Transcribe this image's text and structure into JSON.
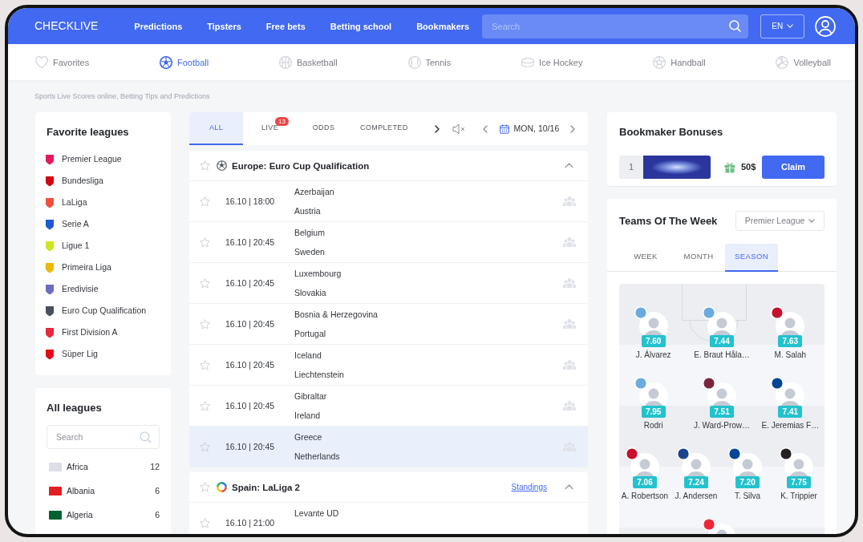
{
  "header": {
    "logo": "CHECKLIVE",
    "menu": [
      "Predictions",
      "Tipsters",
      "Free bets",
      "Betting school",
      "Bookmakers"
    ],
    "search": {
      "placeholder": "Search"
    },
    "language": "EN"
  },
  "sports": [
    {
      "kind": "favorites",
      "label": "Favorites",
      "selected": false
    },
    {
      "kind": "football",
      "label": "Football",
      "selected": true
    },
    {
      "kind": "basketball",
      "label": "Basketball",
      "selected": false
    },
    {
      "kind": "tennis",
      "label": "Tennis",
      "selected": false
    },
    {
      "kind": "ice_hockey",
      "label": "Ice Hockey",
      "selected": false
    },
    {
      "kind": "handball",
      "label": "Handball",
      "selected": false
    },
    {
      "kind": "volleyball",
      "label": "Volleyball",
      "selected": false
    }
  ],
  "tagline": "Sports Live Scores online, Betting Tips and Predictions",
  "favorite_leagues": {
    "title": "Favorite leagues",
    "items": [
      {
        "name": "Premier League",
        "color": "#e5195f"
      },
      {
        "name": "Bundesliga",
        "color": "#d20515"
      },
      {
        "name": "LaLiga",
        "color": "#f0503c"
      },
      {
        "name": "Serie A",
        "color": "#1e5ad2"
      },
      {
        "name": "Ligue 1",
        "color": "#cde61e"
      },
      {
        "name": "Primeira Liga",
        "color": "#e8b90c"
      },
      {
        "name": "Eredivisie",
        "color": "#6c6cc0"
      },
      {
        "name": "Euro Cup Qualification",
        "color": "#4a4f5c"
      },
      {
        "name": "First Division A",
        "color": "#e8283c"
      },
      {
        "name": "Süper Lig",
        "color": "#e30a17"
      }
    ]
  },
  "all_leagues": {
    "title": "All leagues",
    "search": {
      "placeholder": "Search"
    },
    "items": [
      {
        "name": "Africa",
        "count": "12",
        "color": "#dcdfe8"
      },
      {
        "name": "Albania",
        "count": "6",
        "color": "#e41e20"
      },
      {
        "name": "Algeria",
        "count": "6",
        "color": "#006233"
      }
    ]
  },
  "match_tabs": [
    {
      "label": "ALL",
      "selected": true
    },
    {
      "label": "LIVE",
      "badge": "13",
      "selected": false
    },
    {
      "label": "ODDS",
      "selected": false
    },
    {
      "label": "COMPLETED",
      "selected": false
    }
  ],
  "date": "MON, 10/16",
  "groups": [
    {
      "kind": "cup",
      "title": "Europe: Euro Cup Qualification",
      "expanded": true,
      "matches": [
        {
          "time": "16.10 | 18:00",
          "home": "Azerbaijan",
          "away": "Austria",
          "selected": false
        },
        {
          "time": "16.10 | 20:45",
          "home": "Belgium",
          "away": "Sweden",
          "selected": false
        },
        {
          "time": "16.10 | 20:45",
          "home": "Luxembourg",
          "away": "Slovakia",
          "selected": false
        },
        {
          "time": "16.10 | 20:45",
          "home": "Bosnia & Herzegovina",
          "away": "Portugal",
          "selected": false
        },
        {
          "time": "16.10 | 20:45",
          "home": "Iceland",
          "away": "Liechtenstein",
          "selected": false
        },
        {
          "time": "16.10 | 20:45",
          "home": "Gibraltar",
          "away": "Ireland",
          "selected": false
        },
        {
          "time": "16.10 | 20:45",
          "home": "Greece",
          "away": "Netherlands",
          "selected": true
        }
      ]
    },
    {
      "kind": "league",
      "title": "Spain: LaLiga 2",
      "link": "Standings",
      "expanded": true,
      "matches": [
        {
          "time": "16.10 | 21:00",
          "home": "Levante UD",
          "selected": false
        }
      ]
    }
  ],
  "bonuses": {
    "title": "Bookmaker Bonuses",
    "offers": [
      {
        "rank": "1",
        "amount": "50$",
        "action": "Claim"
      }
    ]
  },
  "teams_of_the_week": {
    "title": "Teams Of The Week",
    "league": "Premier League",
    "tabs": [
      {
        "label": "WEEK",
        "selected": false
      },
      {
        "label": "MONTH",
        "selected": false
      },
      {
        "label": "SEASON",
        "selected": true
      }
    ],
    "lineup": [
      [
        {
          "name": "J. Álvarez",
          "rating": "7.60",
          "color": "#6cabdd"
        },
        {
          "name": "E. Braut Håla…",
          "rating": "7.44",
          "color": "#6cabdd"
        },
        {
          "name": "M. Salah",
          "rating": "7.63",
          "color": "#c8102e"
        }
      ],
      [
        {
          "name": "Rodri",
          "rating": "7.95",
          "color": "#6cabdd"
        },
        {
          "name": "J. Ward-Prow…",
          "rating": "7.51",
          "color": "#7a263a"
        },
        {
          "name": "E. Jeremias F…",
          "rating": "7.41",
          "color": "#034694"
        }
      ],
      [
        {
          "name": "A. Robertson",
          "rating": "7.06",
          "color": "#c8102e"
        },
        {
          "name": "J. Andersen",
          "rating": "7.24",
          "color": "#1b458f"
        },
        {
          "name": "T. Silva",
          "rating": "7.20",
          "color": "#034694"
        },
        {
          "name": "K. Trippier",
          "rating": "7.75",
          "color": "#241f20"
        }
      ],
      [
        {
          "color": "#ee2737"
        }
      ]
    ]
  }
}
